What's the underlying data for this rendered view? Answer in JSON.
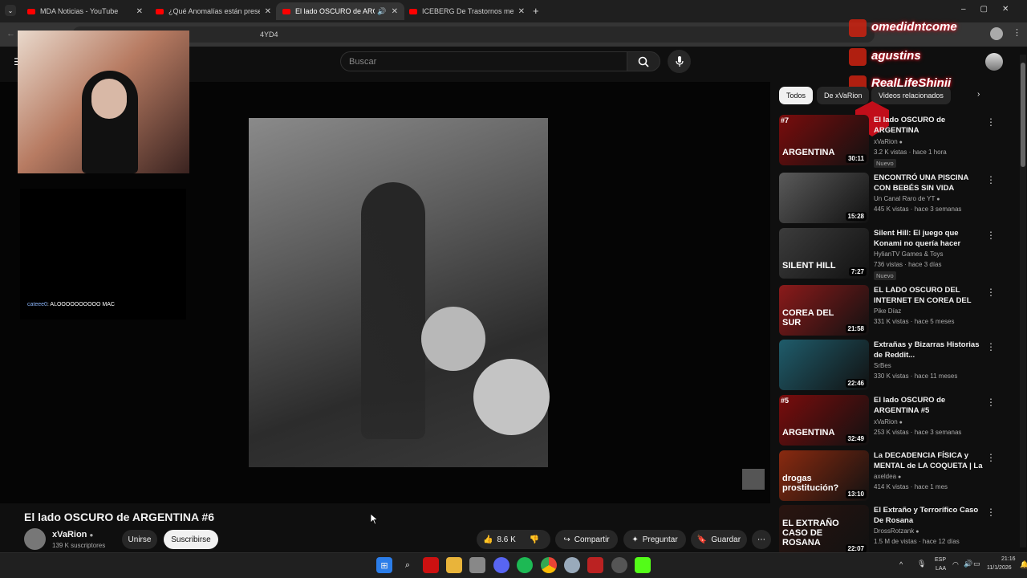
{
  "browser": {
    "tabs": [
      {
        "title": "MDA Noticias - YouTube",
        "active": false
      },
      {
        "title": "¿Qué Anomalías están presente",
        "active": false
      },
      {
        "title": "El lado OSCURO de ARGEN",
        "active": true
      },
      {
        "title": "ICEBERG De Trastornos mentale",
        "active": false
      }
    ],
    "url_fragment": "4YD4",
    "new_tab_label": "+"
  },
  "youtube": {
    "search_placeholder": "Buscar",
    "video": {
      "title": "El lado OSCURO de ARGENTINA #6",
      "channel": "xVaRion",
      "subscribers": "139 K suscriptores",
      "join_label": "Unirse",
      "subscribe_label": "Suscribirse",
      "likes": "8.6 K",
      "share_label": "Compartir",
      "ask_label": "Preguntar",
      "save_label": "Guardar"
    },
    "filter_chips": [
      {
        "label": "Todos",
        "selected": true
      },
      {
        "label": "De xVaRion",
        "selected": false
      },
      {
        "label": "Videos relacionados",
        "selected": false
      }
    ],
    "recommendations": [
      {
        "badge": "#7",
        "title": "El lado OSCURO de ARGENTINA",
        "channel": "xVaRion",
        "verified": true,
        "meta": "3.2 K vistas · hace 1 hora",
        "new": "Nuevo",
        "duration": "30:11",
        "thumb_text": "ARGENTINA",
        "thumb_color": "#7a0c0c"
      },
      {
        "badge": "",
        "title": "ENCONTRÓ UNA PISCINA CON BEBÉS SIN VIDA",
        "channel": "Un Canal Raro de YT",
        "verified": true,
        "meta": "445 K vistas · hace 3 semanas",
        "new": "",
        "duration": "15:28",
        "thumb_text": "",
        "thumb_color": "#5a5a5a"
      },
      {
        "badge": "",
        "title": "Silent Hill: El juego que Konami no quería hacer",
        "channel": "HylianTV Games & Toys",
        "verified": false,
        "meta": "736 vistas · hace 3 días",
        "new": "Nuevo",
        "duration": "7:27",
        "thumb_text": "SILENT HILL",
        "thumb_color": "#3c3c3c"
      },
      {
        "badge": "",
        "title": "EL LADO OSCURO DEL INTERNET EN COREA DEL SU...",
        "channel": "Pike Díaz",
        "verified": false,
        "meta": "331 K vistas · hace 5 meses",
        "new": "",
        "duration": "21:58",
        "thumb_text": "COREA DEL SUR",
        "thumb_color": "#8b1a1a"
      },
      {
        "badge": "",
        "title": "Extrañas y Bizarras Historias de Reddit...",
        "channel": "SrBes",
        "verified": false,
        "meta": "330 K vistas · hace 11 meses",
        "new": "",
        "duration": "22:46",
        "thumb_text": "",
        "thumb_color": "#1f5c6b"
      },
      {
        "badge": "#5",
        "title": "El lado OSCURO de ARGENTINA #5",
        "channel": "xVaRion",
        "verified": true,
        "meta": "253 K vistas · hace 3 semanas",
        "new": "",
        "duration": "32:49",
        "thumb_text": "ARGENTINA",
        "thumb_color": "#7a0c0c"
      },
      {
        "badge": "",
        "title": "La DECADENCIA FÍSICA y MENTAL de LA COQUETA | La ...",
        "channel": "axeldea",
        "verified": true,
        "meta": "414 K vistas · hace 1 mes",
        "new": "",
        "duration": "13:10",
        "thumb_text": "drogas prostitución?",
        "thumb_color": "#8a2a10"
      },
      {
        "badge": "",
        "title": "El Extraño y Terrorífico Caso De Rosana",
        "channel": "DrossRotzank",
        "verified": true,
        "meta": "1.5 M de vistas · hace 12 días",
        "new": "",
        "duration": "22:07",
        "thumb_text": "EL EXTRAÑO CASO DE ROSANA",
        "thumb_color": "#2a1410"
      }
    ]
  },
  "stream_overlay": {
    "chat_user": "cateee0",
    "chat_message": ": ALOOOOOOOOOO MAC",
    "recent_names": [
      "omedidntcome",
      "agustins",
      "RealLifeShinji"
    ]
  },
  "taskbar": {
    "language": "ESP",
    "layout": "LAA",
    "time": "21:16",
    "date": "11/1/2026"
  }
}
